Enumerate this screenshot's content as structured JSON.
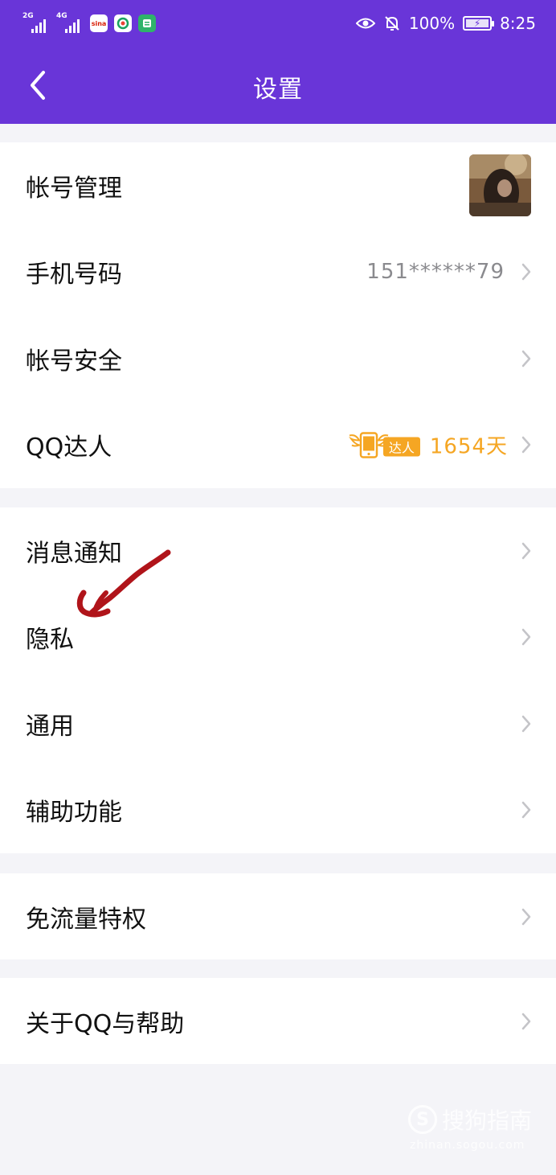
{
  "status_bar": {
    "signal_1_label": "2G",
    "signal_2_label": "4G",
    "app_icons": [
      "sina-icon",
      "browser-icon",
      "news-icon"
    ],
    "battery_percent": "100%",
    "time": "8:25",
    "battery_level": 1.0
  },
  "navbar": {
    "title": "设置"
  },
  "groups": [
    {
      "rows": [
        {
          "label": "帐号管理",
          "type": "avatar"
        },
        {
          "label": "手机号码",
          "value": "151******79",
          "type": "value"
        },
        {
          "label": "帐号安全",
          "type": "plain"
        },
        {
          "label": "QQ达人",
          "badge_text": "达人",
          "days": "1654天",
          "type": "daren"
        }
      ]
    },
    {
      "rows": [
        {
          "label": "消息通知",
          "type": "plain"
        },
        {
          "label": "隐私",
          "type": "plain"
        },
        {
          "label": "通用",
          "type": "plain"
        },
        {
          "label": "辅助功能",
          "type": "plain"
        }
      ]
    },
    {
      "rows": [
        {
          "label": "免流量特权",
          "type": "plain"
        }
      ]
    },
    {
      "rows": [
        {
          "label": "关于QQ与帮助",
          "type": "plain"
        }
      ]
    }
  ],
  "watermark": {
    "logo_letter": "S",
    "text": "搜狗指南",
    "url": "zhinan.sogou.com"
  },
  "colors": {
    "brand": "#6935d8",
    "page_bg": "#f4f4f8",
    "chevron": "#c4c4c8",
    "daren_accent": "#f5a623",
    "annotation_stroke": "#b0141a"
  }
}
